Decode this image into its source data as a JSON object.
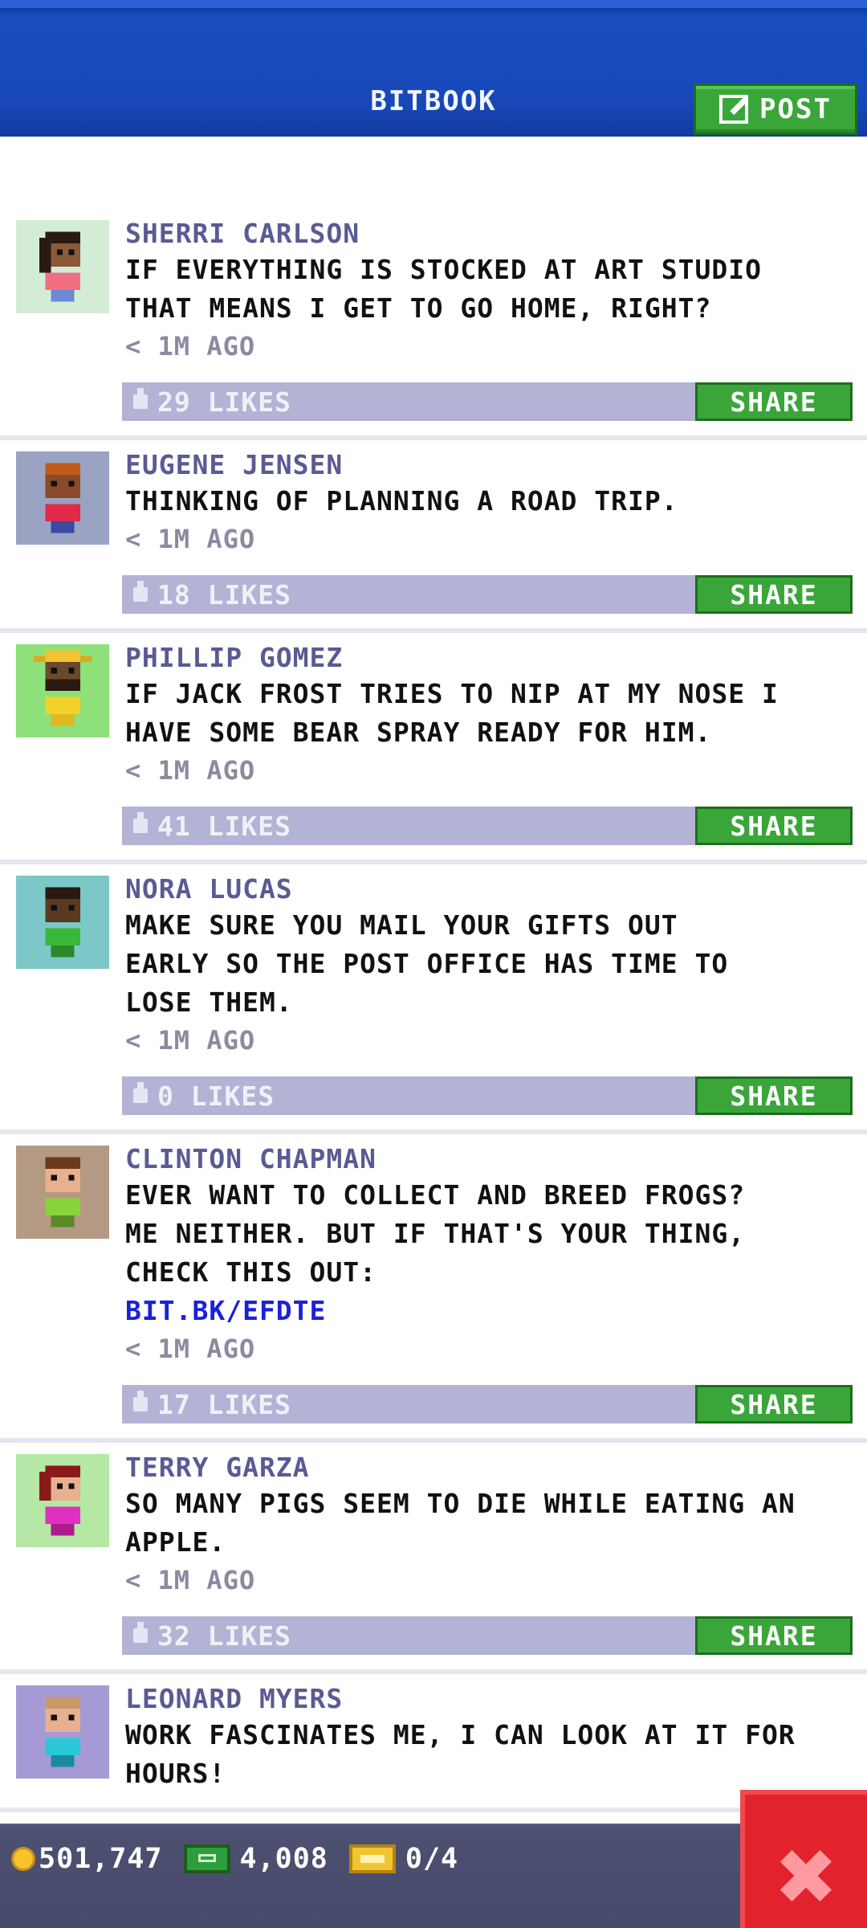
{
  "header": {
    "title": "BITBOOK",
    "post_label": "POST"
  },
  "colors": {
    "header_blue": "#1848b8",
    "green_button": "#3aa63a",
    "like_bar": "#b3b3d6",
    "author_text": "#5a5a94",
    "link_blue": "#1b21d8",
    "close_red": "#e2232b"
  },
  "posts": [
    {
      "author": "SHERRI CARLSON",
      "message": "IF EVERYTHING IS STOCKED AT ART STUDIO\nTHAT MEANS I GET TO GO HOME, RIGHT?",
      "time": "< 1M AGO",
      "likes": "29 LIKES",
      "share": "SHARE",
      "avatar": "avatar-woman-pink-shirt"
    },
    {
      "author": "EUGENE JENSEN",
      "message": "THINKING OF PLANNING A ROAD TRIP.",
      "time": "< 1M AGO",
      "likes": "18 LIKES",
      "share": "SHARE",
      "avatar": "avatar-man-red-shirt"
    },
    {
      "author": "PHILLIP GOMEZ",
      "message": "IF JACK FROST TRIES TO NIP AT MY NOSE I\nHAVE SOME BEAR SPRAY READY FOR HIM.",
      "time": "< 1M AGO",
      "likes": "41 LIKES",
      "share": "SHARE",
      "avatar": "avatar-man-yellow-hat"
    },
    {
      "author": "NORA LUCAS",
      "message": "MAKE SURE YOU MAIL YOUR GIFTS OUT\nEARLY SO THE POST OFFICE HAS TIME TO\nLOSE THEM.",
      "time": "< 1M AGO",
      "likes": "0 LIKES",
      "share": "SHARE",
      "avatar": "avatar-woman-green-shirt"
    },
    {
      "author": "CLINTON CHAPMAN",
      "message": "EVER WANT TO COLLECT AND BREED FROGS?\nME NEITHER. BUT IF THAT'S YOUR THING,\nCHECK THIS OUT:",
      "link": "BIT.BK/EFDTE",
      "time": "< 1M AGO",
      "likes": "17 LIKES",
      "share": "SHARE",
      "avatar": "avatar-man-green-shirt"
    },
    {
      "author": "TERRY GARZA",
      "message": "SO MANY PIGS SEEM TO DIE WHILE EATING AN\nAPPLE.",
      "time": "< 1M AGO",
      "likes": "32 LIKES",
      "share": "SHARE",
      "avatar": "avatar-woman-magenta-shirt"
    },
    {
      "author": "LEONARD MYERS",
      "message": "WORK FASCINATES ME, I CAN LOOK AT IT FOR\nHOURS!",
      "avatar": "avatar-man-teal-shirt"
    }
  ],
  "status_bar": {
    "coins": "501,747",
    "bux": "4,008",
    "tickets": "0/4"
  }
}
